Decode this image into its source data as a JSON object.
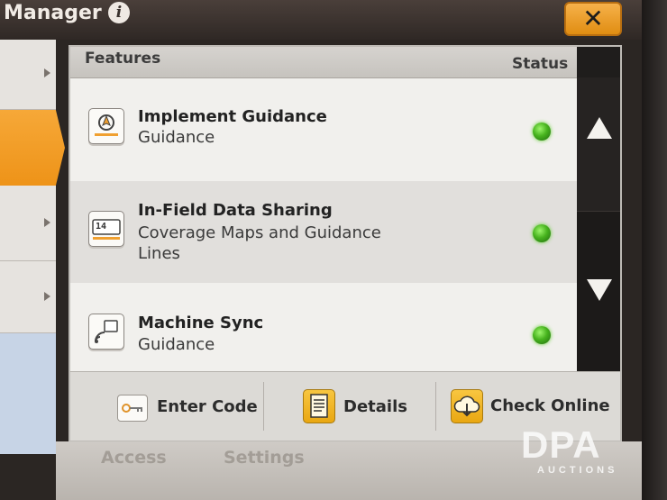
{
  "app": {
    "title": "Manager"
  },
  "header": {
    "features_label": "Features",
    "status_label": "Status"
  },
  "features": [
    {
      "name": "Implement Guidance",
      "subtitle": "Guidance",
      "icon": "implement-guidance-icon",
      "status": "active"
    },
    {
      "name": "In-Field Data Sharing",
      "subtitle": "Coverage Maps and Guidance Lines",
      "icon": "data-sharing-icon",
      "status": "active"
    },
    {
      "name": "Machine Sync",
      "subtitle": "Guidance",
      "icon": "machine-sync-icon",
      "status": "active"
    }
  ],
  "icon_texts": {
    "data_sharing_digits": "14"
  },
  "buttons": {
    "enter_code": "Enter Code",
    "details": "Details",
    "check_online": "Check Online",
    "close": "✕"
  },
  "bottom_tabs": {
    "access": "Access",
    "settings": "Settings"
  },
  "watermark": {
    "brand": "DPA",
    "sub": "AUCTIONS"
  },
  "colors": {
    "accent_orange": "#f0a030",
    "status_green": "#47b31e",
    "scroll_bg": "#1f1d1c"
  }
}
